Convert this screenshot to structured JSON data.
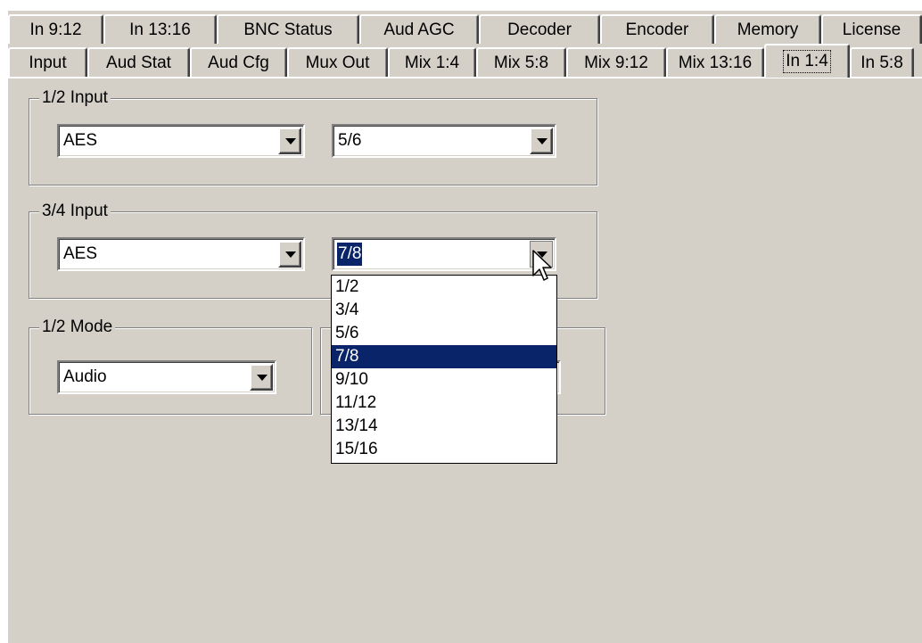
{
  "tabs": {
    "back_row": [
      "In 9:12",
      "In 13:16",
      "BNC Status",
      "Aud AGC",
      "Decoder",
      "Encoder",
      "Memory",
      "License"
    ],
    "front_row": [
      "Input",
      "Aud Stat",
      "Aud Cfg",
      "Mux Out",
      "Mix 1:4",
      "Mix 5:8",
      "Mix 9:12",
      "Mix 13:16",
      "In 1:4",
      "In 5:8"
    ],
    "selected": "In 1:4"
  },
  "groups": {
    "input_12": {
      "legend": "1/2 Input",
      "source": "AES",
      "pair": "5/6"
    },
    "input_34": {
      "legend": "3/4 Input",
      "source": "AES",
      "pair": "7/8"
    },
    "mode_12": {
      "legend": "1/2 Mode",
      "mode": "Audio"
    }
  },
  "dropdown": {
    "options": [
      "1/2",
      "3/4",
      "5/6",
      "7/8",
      "9/10",
      "11/12",
      "13/14",
      "15/16"
    ],
    "selected": "7/8"
  },
  "colors": {
    "face": "#d4d0c8",
    "highlight": "#0a246a"
  }
}
